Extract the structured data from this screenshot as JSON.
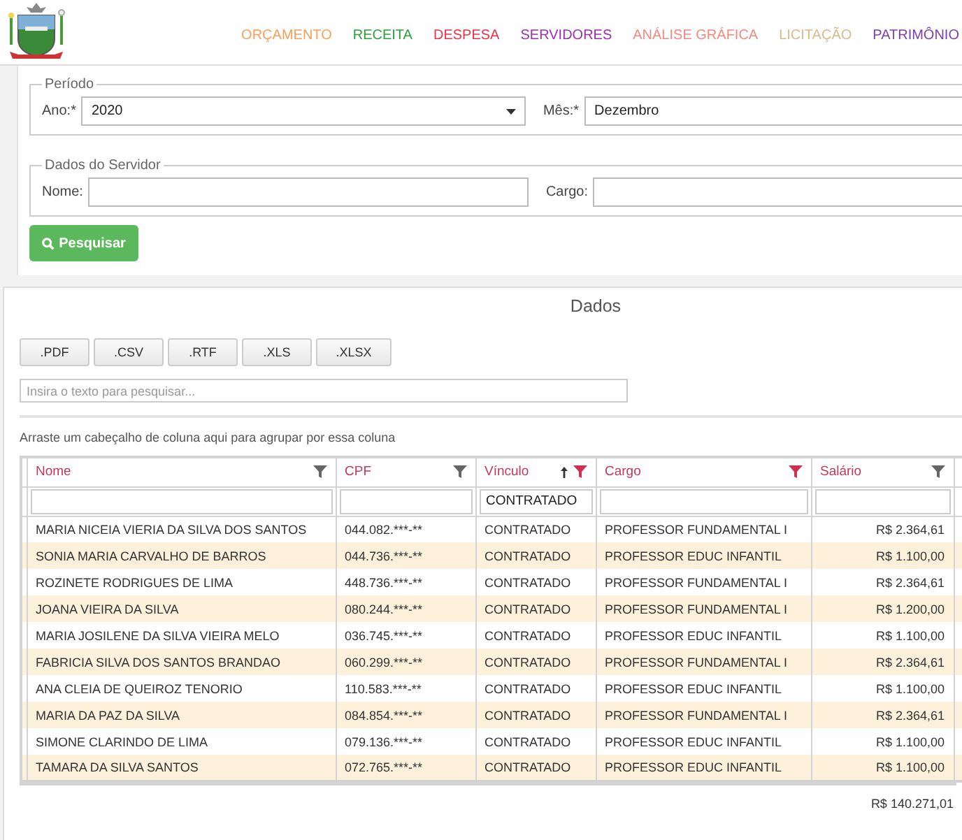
{
  "nav": [
    {
      "label": "ORÇAMENTO",
      "color": "#f5a05a"
    },
    {
      "label": "RECEITA",
      "color": "#2e9e3a"
    },
    {
      "label": "DESPESA",
      "color": "#e8334a"
    },
    {
      "label": "SERVIDORES",
      "color": "#9b2fae"
    },
    {
      "label": "ANÁLISE GRÁFICA",
      "color": "#f08a80"
    },
    {
      "label": "LICITAÇÃO",
      "color": "#d9b98c"
    },
    {
      "label": "PATRIMÔNIO",
      "color": "#7b3fa8"
    }
  ],
  "period": {
    "legend": "Período",
    "year": {
      "label": "Ano:*",
      "value": "2020"
    },
    "month": {
      "label": "Mês:*",
      "value": "Dezembro"
    }
  },
  "server": {
    "legend": "Dados do Servidor",
    "name": {
      "label": "Nome:"
    },
    "role": {
      "label": "Cargo:"
    }
  },
  "search_button": "Pesquisar",
  "data": {
    "title": "Dados",
    "export_buttons": [
      ".PDF",
      ".CSV",
      ".RTF",
      ".XLS",
      ".XLSX"
    ],
    "search": {
      "placeholder": "Insira o texto para pesquisar..."
    },
    "group_hint": "Arraste um cabeçalho de coluna aqui para agrupar por essa coluna",
    "columns": [
      {
        "label": "Nome",
        "filter_active": false,
        "sorted": false
      },
      {
        "label": "CPF",
        "filter_active": false,
        "sorted": false
      },
      {
        "label": "Vínculo",
        "filter_active": true,
        "sorted": true,
        "filter_value": "CONTRATADO"
      },
      {
        "label": "Cargo",
        "filter_active": true,
        "sorted": false
      },
      {
        "label": "Salário",
        "filter_active": false,
        "sorted": false
      }
    ],
    "rows": [
      [
        "MARIA NICEIA VIERIA DA SILVA DOS SANTOS",
        "044.082.***-**",
        "CONTRATADO",
        "PROFESSOR FUNDAMENTAL I",
        "R$ 2.364,61"
      ],
      [
        "SONIA MARIA CARVALHO DE BARROS",
        "044.736.***-**",
        "CONTRATADO",
        "PROFESSOR EDUC INFANTIL",
        "R$ 1.100,00"
      ],
      [
        "ROZINETE RODRIGUES DE LIMA",
        "448.736.***-**",
        "CONTRATADO",
        "PROFESSOR FUNDAMENTAL I",
        "R$ 2.364,61"
      ],
      [
        "JOANA VIEIRA DA SILVA",
        "080.244.***-**",
        "CONTRATADO",
        "PROFESSOR FUNDAMENTAL I",
        "R$ 1.200,00"
      ],
      [
        "MARIA JOSILENE DA SILVA VIEIRA MELO",
        "036.745.***-**",
        "CONTRATADO",
        "PROFESSOR EDUC INFANTIL",
        "R$ 1.100,00"
      ],
      [
        "FABRICIA SILVA DOS SANTOS BRANDAO",
        "060.299.***-**",
        "CONTRATADO",
        "PROFESSOR FUNDAMENTAL I",
        "R$ 2.364,61"
      ],
      [
        "ANA CLEIA DE QUEIROZ TENORIO",
        "110.583.***-**",
        "CONTRATADO",
        "PROFESSOR EDUC INFANTIL",
        "R$ 1.100,00"
      ],
      [
        "MARIA DA PAZ DA SILVA",
        "084.854.***-**",
        "CONTRATADO",
        "PROFESSOR FUNDAMENTAL I",
        "R$ 2.364,61"
      ],
      [
        "SIMONE CLARINDO DE LIMA",
        "079.136.***-**",
        "CONTRATADO",
        "PROFESSOR EDUC INFANTIL",
        "R$ 1.100,00"
      ],
      [
        "TAMARA DA SILVA SANTOS",
        "072.765.***-**",
        "CONTRATADO",
        "PROFESSOR EDUC INFANTIL",
        "R$ 1.100,00"
      ]
    ],
    "total": "R$ 140.271,01"
  }
}
